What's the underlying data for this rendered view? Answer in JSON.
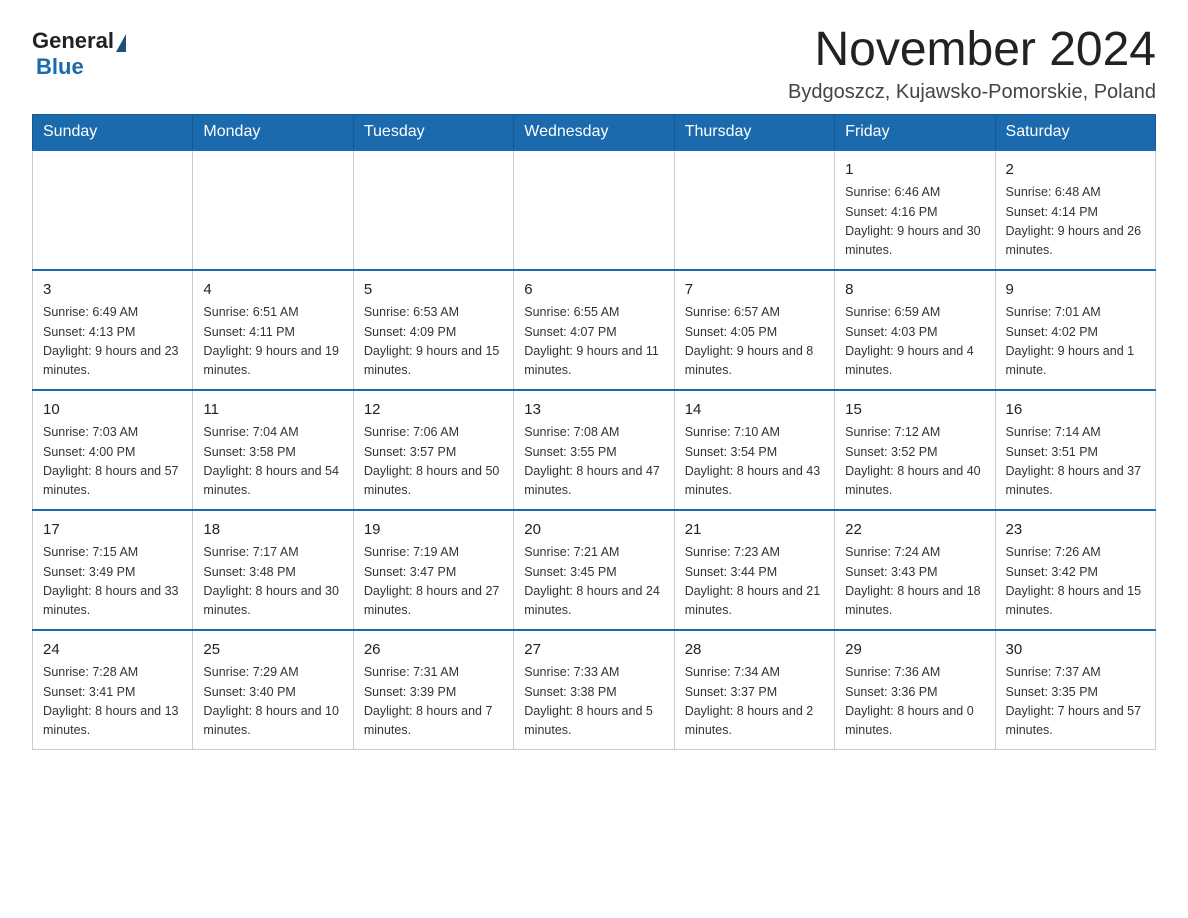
{
  "logo": {
    "general": "General",
    "blue": "Blue"
  },
  "title": "November 2024",
  "location": "Bydgoszcz, Kujawsko-Pomorskie, Poland",
  "weekdays": [
    "Sunday",
    "Monday",
    "Tuesday",
    "Wednesday",
    "Thursday",
    "Friday",
    "Saturday"
  ],
  "weeks": [
    [
      {
        "day": "",
        "info": ""
      },
      {
        "day": "",
        "info": ""
      },
      {
        "day": "",
        "info": ""
      },
      {
        "day": "",
        "info": ""
      },
      {
        "day": "",
        "info": ""
      },
      {
        "day": "1",
        "info": "Sunrise: 6:46 AM\nSunset: 4:16 PM\nDaylight: 9 hours and 30 minutes."
      },
      {
        "day": "2",
        "info": "Sunrise: 6:48 AM\nSunset: 4:14 PM\nDaylight: 9 hours and 26 minutes."
      }
    ],
    [
      {
        "day": "3",
        "info": "Sunrise: 6:49 AM\nSunset: 4:13 PM\nDaylight: 9 hours and 23 minutes."
      },
      {
        "day": "4",
        "info": "Sunrise: 6:51 AM\nSunset: 4:11 PM\nDaylight: 9 hours and 19 minutes."
      },
      {
        "day": "5",
        "info": "Sunrise: 6:53 AM\nSunset: 4:09 PM\nDaylight: 9 hours and 15 minutes."
      },
      {
        "day": "6",
        "info": "Sunrise: 6:55 AM\nSunset: 4:07 PM\nDaylight: 9 hours and 11 minutes."
      },
      {
        "day": "7",
        "info": "Sunrise: 6:57 AM\nSunset: 4:05 PM\nDaylight: 9 hours and 8 minutes."
      },
      {
        "day": "8",
        "info": "Sunrise: 6:59 AM\nSunset: 4:03 PM\nDaylight: 9 hours and 4 minutes."
      },
      {
        "day": "9",
        "info": "Sunrise: 7:01 AM\nSunset: 4:02 PM\nDaylight: 9 hours and 1 minute."
      }
    ],
    [
      {
        "day": "10",
        "info": "Sunrise: 7:03 AM\nSunset: 4:00 PM\nDaylight: 8 hours and 57 minutes."
      },
      {
        "day": "11",
        "info": "Sunrise: 7:04 AM\nSunset: 3:58 PM\nDaylight: 8 hours and 54 minutes."
      },
      {
        "day": "12",
        "info": "Sunrise: 7:06 AM\nSunset: 3:57 PM\nDaylight: 8 hours and 50 minutes."
      },
      {
        "day": "13",
        "info": "Sunrise: 7:08 AM\nSunset: 3:55 PM\nDaylight: 8 hours and 47 minutes."
      },
      {
        "day": "14",
        "info": "Sunrise: 7:10 AM\nSunset: 3:54 PM\nDaylight: 8 hours and 43 minutes."
      },
      {
        "day": "15",
        "info": "Sunrise: 7:12 AM\nSunset: 3:52 PM\nDaylight: 8 hours and 40 minutes."
      },
      {
        "day": "16",
        "info": "Sunrise: 7:14 AM\nSunset: 3:51 PM\nDaylight: 8 hours and 37 minutes."
      }
    ],
    [
      {
        "day": "17",
        "info": "Sunrise: 7:15 AM\nSunset: 3:49 PM\nDaylight: 8 hours and 33 minutes."
      },
      {
        "day": "18",
        "info": "Sunrise: 7:17 AM\nSunset: 3:48 PM\nDaylight: 8 hours and 30 minutes."
      },
      {
        "day": "19",
        "info": "Sunrise: 7:19 AM\nSunset: 3:47 PM\nDaylight: 8 hours and 27 minutes."
      },
      {
        "day": "20",
        "info": "Sunrise: 7:21 AM\nSunset: 3:45 PM\nDaylight: 8 hours and 24 minutes."
      },
      {
        "day": "21",
        "info": "Sunrise: 7:23 AM\nSunset: 3:44 PM\nDaylight: 8 hours and 21 minutes."
      },
      {
        "day": "22",
        "info": "Sunrise: 7:24 AM\nSunset: 3:43 PM\nDaylight: 8 hours and 18 minutes."
      },
      {
        "day": "23",
        "info": "Sunrise: 7:26 AM\nSunset: 3:42 PM\nDaylight: 8 hours and 15 minutes."
      }
    ],
    [
      {
        "day": "24",
        "info": "Sunrise: 7:28 AM\nSunset: 3:41 PM\nDaylight: 8 hours and 13 minutes."
      },
      {
        "day": "25",
        "info": "Sunrise: 7:29 AM\nSunset: 3:40 PM\nDaylight: 8 hours and 10 minutes."
      },
      {
        "day": "26",
        "info": "Sunrise: 7:31 AM\nSunset: 3:39 PM\nDaylight: 8 hours and 7 minutes."
      },
      {
        "day": "27",
        "info": "Sunrise: 7:33 AM\nSunset: 3:38 PM\nDaylight: 8 hours and 5 minutes."
      },
      {
        "day": "28",
        "info": "Sunrise: 7:34 AM\nSunset: 3:37 PM\nDaylight: 8 hours and 2 minutes."
      },
      {
        "day": "29",
        "info": "Sunrise: 7:36 AM\nSunset: 3:36 PM\nDaylight: 8 hours and 0 minutes."
      },
      {
        "day": "30",
        "info": "Sunrise: 7:37 AM\nSunset: 3:35 PM\nDaylight: 7 hours and 57 minutes."
      }
    ]
  ]
}
